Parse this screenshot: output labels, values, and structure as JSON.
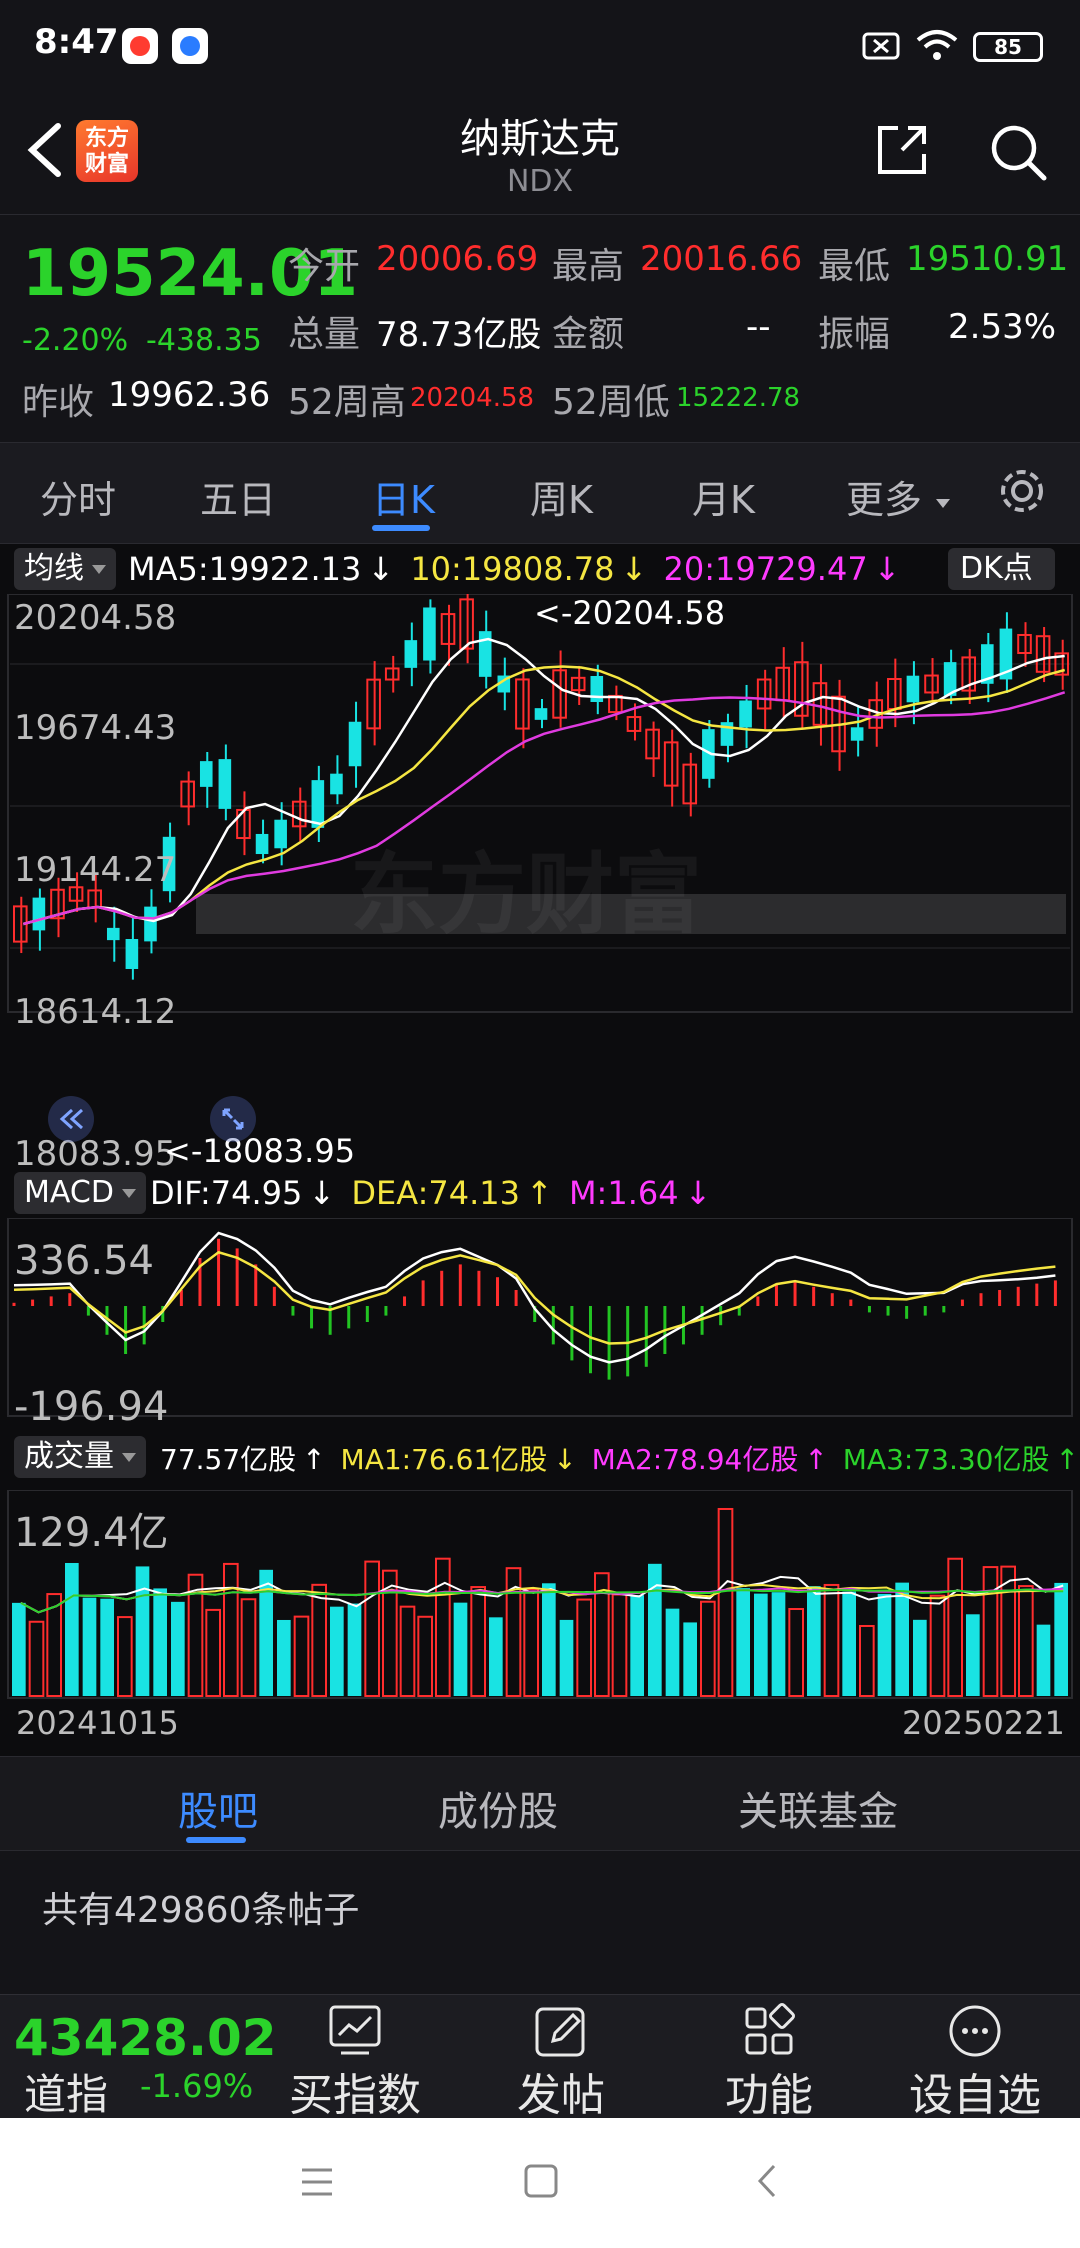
{
  "status_bar": {
    "time": "8:47",
    "battery": "85"
  },
  "header": {
    "title": "纳斯达克",
    "subtitle": "NDX",
    "logo_text_line1": "东方",
    "logo_text_line2": "财富"
  },
  "quote": {
    "last_price": "19524.01",
    "pct_change": "-2.20%",
    "abs_change": "-438.35",
    "open_label": "今开",
    "open_value": "20006.69",
    "high_label": "最高",
    "high_value": "20016.66",
    "low_label": "最低",
    "low_value": "19510.91",
    "volume_label": "总量",
    "volume_value": "78.73亿股",
    "amount_label": "金额",
    "amount_value": "--",
    "amplitude_label": "振幅",
    "amplitude_value": "2.53%",
    "prev_close_label": "昨收",
    "prev_close_value": "19962.36",
    "high52_label": "52周高",
    "high52_value": "20204.58",
    "low52_label": "52周低",
    "low52_value": "15222.78"
  },
  "period_tabs": [
    "分时",
    "五日",
    "日K",
    "周K",
    "月K",
    "更多"
  ],
  "active_period": "日K",
  "kline": {
    "indicator_chip": "均线",
    "ma5": "MA5:19922.13",
    "ma10": "10:19808.78",
    "ma20": "20:19729.47",
    "dk_button": "DK点",
    "axis": [
      "20204.58",
      "19674.43",
      "19144.27",
      "18614.12",
      "18083.95"
    ],
    "max_marker": "<-20204.58",
    "min_marker": "<-18083.95",
    "watermark": "东方财富",
    "colors": {
      "up": "#ff2d2d",
      "down": "#19e3e3",
      "ma5": "#ffffff",
      "ma10": "#f5e642",
      "ma20": "#e03be0"
    }
  },
  "macd": {
    "chip": "MACD",
    "dif": "DIF:74.95",
    "dea": "DEA:74.13",
    "m": "M:1.64",
    "axis_top": "336.54",
    "axis_bottom": "-196.94"
  },
  "volume": {
    "chip": "成交量",
    "current": "77.57亿股",
    "ma1": "MA1:76.61亿股",
    "ma2": "MA2:78.94亿股",
    "ma3": "MA3:73.30亿股",
    "axis_top": "129.4亿",
    "date_start": "20241015",
    "date_end": "20250221"
  },
  "sub_tabs": [
    "股吧",
    "成份股",
    "关联基金"
  ],
  "active_sub_tab": "股吧",
  "post_count": "共有429860条帖子",
  "action_bar": {
    "ticker_price": "43428.02",
    "ticker_name": "道指",
    "ticker_pct": "-1.69%",
    "actions": [
      "买指数",
      "发帖",
      "功能",
      "设自选"
    ]
  }
}
